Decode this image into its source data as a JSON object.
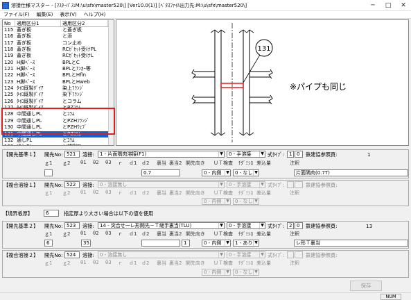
{
  "window": {
    "title": "溶接仕様マスター - [ﾏｽﾀｰﾊﾟｽ:M:\\u\\sfx\\master520\\] [Ver10.0(1)] [ﾍﾞﾀｽﾌｧｲﾙ出力先:M:\\u\\sfx\\master520\\]",
    "minimize": "─",
    "maximize": "□",
    "close": "✕"
  },
  "menu": [
    "ファイル(F)",
    "編集(E)",
    "表示(V)",
    "ヘルプ(H)"
  ],
  "list": {
    "headers": [
      "No",
      "適用区分1",
      "適用区分2"
    ],
    "rows": [
      [
        "115",
        "蓋ぎ板",
        "と蓋ぎ板"
      ],
      [
        "116",
        "蓋ぎ板",
        "と添"
      ],
      [
        "117",
        "蓋ぎ板",
        "コン止め"
      ],
      [
        "118",
        "蓋ぎ板",
        "RCｶﾞｾｯﾄ受けPL"
      ],
      [
        "119",
        "蓋ぎ板",
        "RCｶﾞｾｯﾄ受けL"
      ],
      [
        "120",
        "H脚ﾍﾞｰｽ",
        "BPLとC"
      ],
      [
        "121",
        "H脚ﾍﾞｰｽ",
        "BPLとｱﾝｶｰ等"
      ],
      [
        "122",
        "H脚ﾍﾞｰｽ",
        "BPLとHfln"
      ],
      [
        "123",
        "H脚ﾍﾞｰｽ",
        "BPLとHweb"
      ],
      [
        "124",
        "ﾀｲﾛ既製ﾀﾞｲｱ",
        "染上ﾌﾗﾝｼﾞ"
      ],
      [
        "125",
        "ﾀｲﾛ既製ﾀﾞｲｱ",
        "染下ﾌﾗﾝｼﾞ"
      ],
      [
        "126",
        "ﾀｲﾛ既製ﾀﾞｲｱ",
        "とコラム"
      ],
      [
        "127",
        "ﾀｲﾛ既製ﾀﾞｲｱ",
        "とPZｺﾗﾑ"
      ],
      [
        "128",
        "中間通しPL",
        "とｺﾗﾑ"
      ],
      [
        "129",
        "中間通しPL",
        "とPZHﾌﾗﾝｼﾞ"
      ],
      [
        "130",
        "中間通しPL",
        "とPZHｳｪﾌﾞ"
      ],
      [
        "131",
        "中間通しPL",
        "とPZｺﾗﾑ"
      ],
      [
        "132",
        "通しPL",
        "とｺﾗﾑ"
      ],
      [
        "133",
        "通しPL",
        "と補剛PL"
      ]
    ],
    "selected_index": 16
  },
  "drawing": {
    "callout_number": "131",
    "note": "※パイプも同じ"
  },
  "form": {
    "kaisaki1": {
      "title": "【開先基準１】",
      "kaisaki_no_label": "開先No:",
      "kaisaki_no": "521",
      "yousetsu_label": "溶接:",
      "yousetsu": "1 - 片面隅肉溶接(F1)",
      "method": "0 - 手溶接",
      "shiki_label": "式ﾀｲﾌﾟ:",
      "shiki_a": "1",
      "shiki_b": "0",
      "tekken_label": "鉄建協参照頁:",
      "tekken": "1",
      "headers": [
        "ｇ1",
        "ｇ2",
        "θ1",
        "θ2",
        "θ3",
        "ｒ",
        "ｄ1",
        "ｄ2",
        "裏当",
        "裏当2",
        "開先向き",
        "ＵＴ検査",
        "ﾁﾀﾞﾐｼﾛ",
        "差込量",
        "注釈"
      ],
      "d2": "0.7",
      "muki": "0 - 内側",
      "ut": "0 - なし",
      "chushaku": "片面隅肉(0.7T)"
    },
    "fukugo1": {
      "title": "【複合溶接１】",
      "kaisaki_no_label": "開先No:",
      "kaisaki_no": "522",
      "yousetsu_label": "溶接:",
      "yousetsu": "0 - 溶接無し",
      "method": "0 - 手溶接",
      "shiki_label": "式ﾀｲﾌﾟ:",
      "tekken_label": "鉄建協参照頁:",
      "headers": [
        "ｇ1",
        "ｇ2",
        "θ1",
        "θ2",
        "θ3",
        "ｒ",
        "ｄ1",
        "ｄ2",
        "裏当",
        "裏当2",
        "開先向き",
        "ＵＴ検査",
        "ﾁﾀﾞﾐｼﾛ",
        "差込量",
        "注釈"
      ],
      "muki": "0 - 内側",
      "ut": "0 - なし"
    },
    "kyokai": {
      "title": "【境界板厚】",
      "value": "6",
      "text": "指定厚より大きい場合は以下の値を使用"
    },
    "kaisaki2": {
      "title": "【開先基準２】",
      "kaisaki_no_label": "開先No:",
      "kaisaki_no": "523",
      "yousetsu_label": "溶接:",
      "yousetsu": "14 - 突合せ一レ形開先－Ｔ継手裏当(TLU)",
      "method": "0 - 手溶接",
      "shiki_label": "式ﾀｲﾌﾟ:",
      "shiki_a": "2",
      "shiki_b": "0",
      "tekken_label": "鉄建協参照頁:",
      "tekken": "13",
      "headers": [
        "ｇ1",
        "ｇ2",
        "θ1",
        "θ2",
        "θ3",
        "ｒ",
        "ｄ1",
        "ｄ2",
        "裏当",
        "裏当2",
        "開先向き",
        "ＵＴ検査",
        "ﾁﾀﾞﾐｼﾛ",
        "差込量",
        "注釈"
      ],
      "g1": "6",
      "t1": "35",
      "ura": "1",
      "muki": "0 - 内側",
      "ut": "1 - あり",
      "chushaku": "レ形Ｔ裏当"
    },
    "fukugo2": {
      "title": "【複合溶接２】",
      "kaisaki_no_label": "開先No:",
      "kaisaki_no": "524",
      "yousetsu_label": "溶接:",
      "yousetsu": "0 - 溶接無し",
      "method": "0 - 手溶接",
      "shiki_label": "式ﾀｲﾌﾟ:",
      "tekken_label": "鉄建協参照頁:",
      "headers": [
        "ｇ1",
        "ｇ2",
        "θ1",
        "θ2",
        "θ3",
        "ｒ",
        "ｄ1",
        "ｄ2",
        "裏当",
        "裏当2",
        "開先向き",
        "ＵＴ検査",
        "ﾁﾀﾞﾐｼﾛ",
        "差込量",
        "注釈"
      ],
      "muki": "0 - 内側",
      "ut": "0 - なし"
    },
    "save_label": "保存"
  },
  "status": {
    "num": "NUM"
  },
  "colors": {
    "selection": "#0a64d8",
    "highlight_box": "#e01e1e",
    "weld_line": "#e01e1e"
  }
}
